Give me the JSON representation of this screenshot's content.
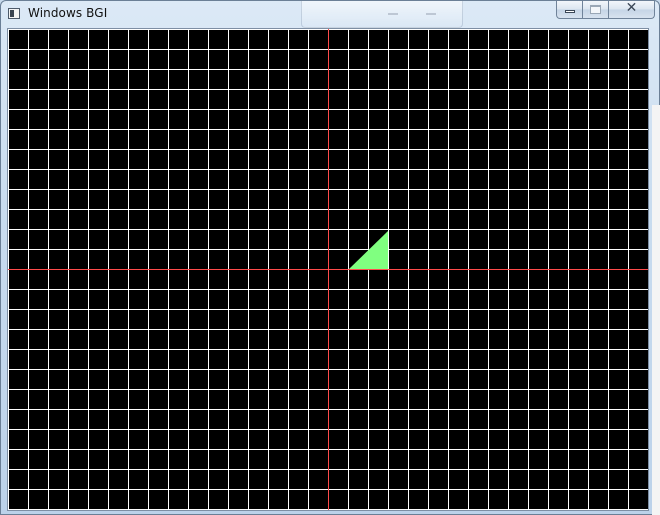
{
  "window": {
    "title": "Windows BGI",
    "app_icon": "bgi-window-icon",
    "caption_buttons": {
      "minimize_icon": "minimize-icon",
      "maximize_icon": "maximize-icon",
      "close_icon": "close-icon",
      "close_glyph": "✕"
    }
  },
  "canvas": {
    "background": "#000000",
    "grid_color": "#ffffff",
    "axis_color": "#ff4d4d",
    "shape_fill": "#80ff80",
    "shape": "right-triangle"
  }
}
